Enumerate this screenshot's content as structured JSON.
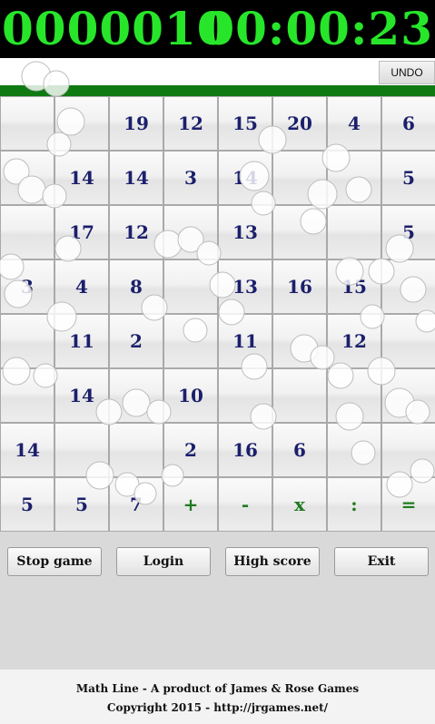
{
  "header": {
    "score": "0000010",
    "timer": "00:00:23"
  },
  "input": {
    "expression": "",
    "undo_label": "UNDO"
  },
  "progress": {
    "fraction": 1.0,
    "color": "#0f7a12"
  },
  "grid": {
    "rows": [
      [
        "",
        "",
        "19",
        "12",
        "15",
        "20",
        "4",
        "6"
      ],
      [
        "",
        "14",
        "14",
        "3",
        "14",
        "",
        "",
        "5"
      ],
      [
        "",
        "17",
        "12",
        "",
        "13",
        "",
        "",
        "5"
      ],
      [
        "3",
        "4",
        "8",
        "",
        "13",
        "16",
        "15",
        ""
      ],
      [
        "",
        "11",
        "2",
        "",
        "11",
        "",
        "12",
        ""
      ],
      [
        "",
        "14",
        "",
        "10",
        "",
        "",
        "",
        ""
      ],
      [
        "14",
        "",
        "",
        "2",
        "16",
        "6",
        "",
        ""
      ],
      [
        "5",
        "5",
        "7",
        "+",
        "-",
        "x",
        ":",
        "="
      ]
    ]
  },
  "controls": {
    "stop": "Stop game",
    "login": "Login",
    "highscore": "High score",
    "exit": "Exit"
  },
  "footer": {
    "line1": "Math Line - A product of James & Rose Games",
    "line2": "Copyright 2015 - http://jrgames.net/"
  },
  "colors": {
    "number": "#1b1f6b",
    "operator": "#1f7a1f",
    "digits": "#27e62a"
  }
}
